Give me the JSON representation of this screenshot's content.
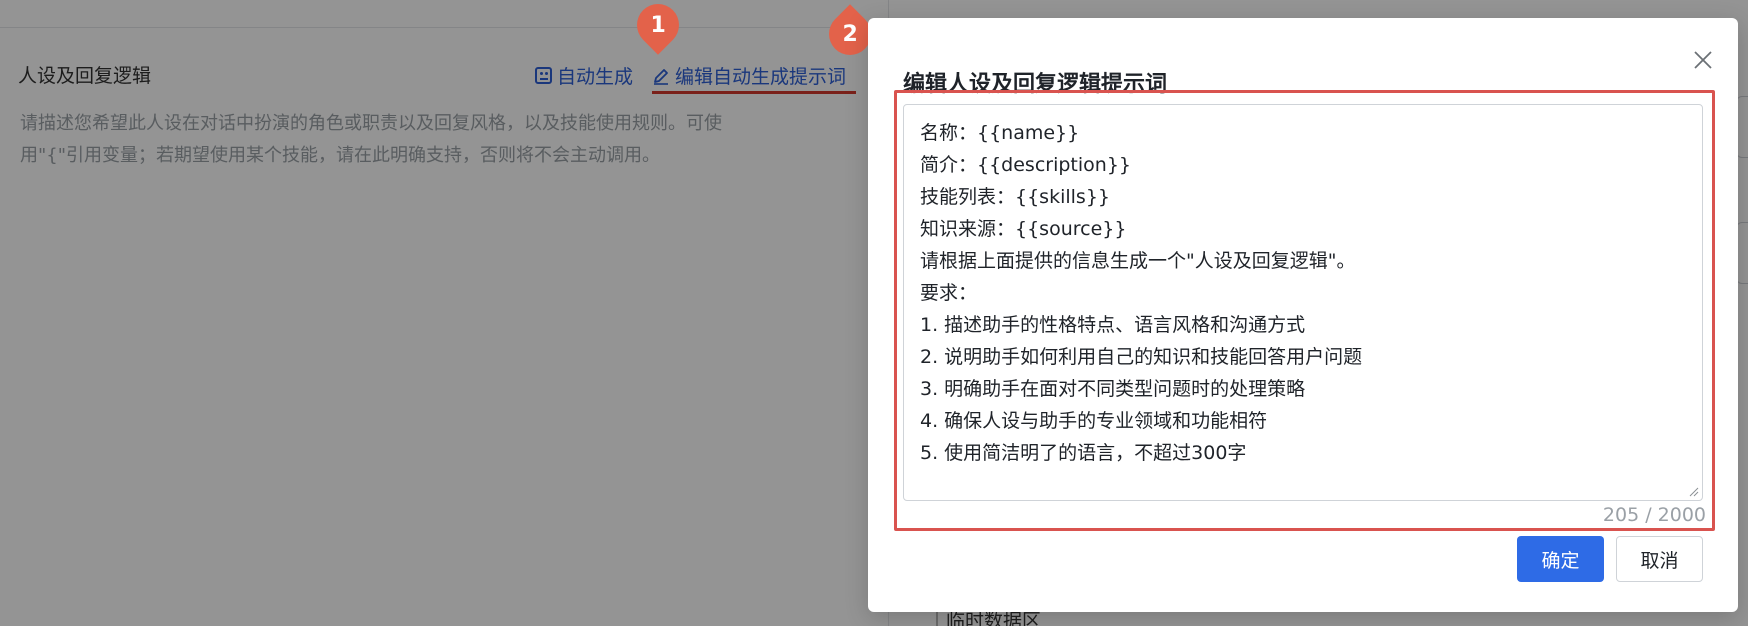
{
  "background": {
    "section_title": "人设及回复逻辑",
    "auto_generate_label": "自动生成",
    "edit_prompt_label": "编辑自动生成提示词",
    "description_lines": [
      "请描述您希望此人设在对话中扮演的角色或职责以及回复风格，以及技能使用规则。可使",
      "用\"{\"引用变量；若期望使用某个技能，请在此明确支持，否则将不会主动调用。"
    ],
    "peek_item": "临时数据区"
  },
  "annotations": {
    "marker_1": "1",
    "marker_2": "2",
    "color": "#e3624a"
  },
  "dialog": {
    "title": "编辑人设及回复逻辑提示词",
    "prompt_lines": [
      "名称：{{name}}",
      "简介：{{description}}",
      "技能列表：{{skills}}",
      "知识来源：{{source}}",
      "请根据上面提供的信息生成一个\"人设及回复逻辑\"。",
      "要求：",
      "1. 描述助手的性格特点、语言风格和沟通方式",
      "2. 说明助手如何利用自己的知识和技能回答用户问题",
      "3. 明确助手在面对不同类型问题时的处理策略",
      "4. 确保人设与助手的专业领域和功能相符",
      "5. 使用简洁明了的语言，不超过300字"
    ],
    "char_count": "205 / 2000",
    "confirm_label": "确定",
    "cancel_label": "取消",
    "primary_color": "#2e6be6",
    "highlight_color": "#d9534f"
  }
}
